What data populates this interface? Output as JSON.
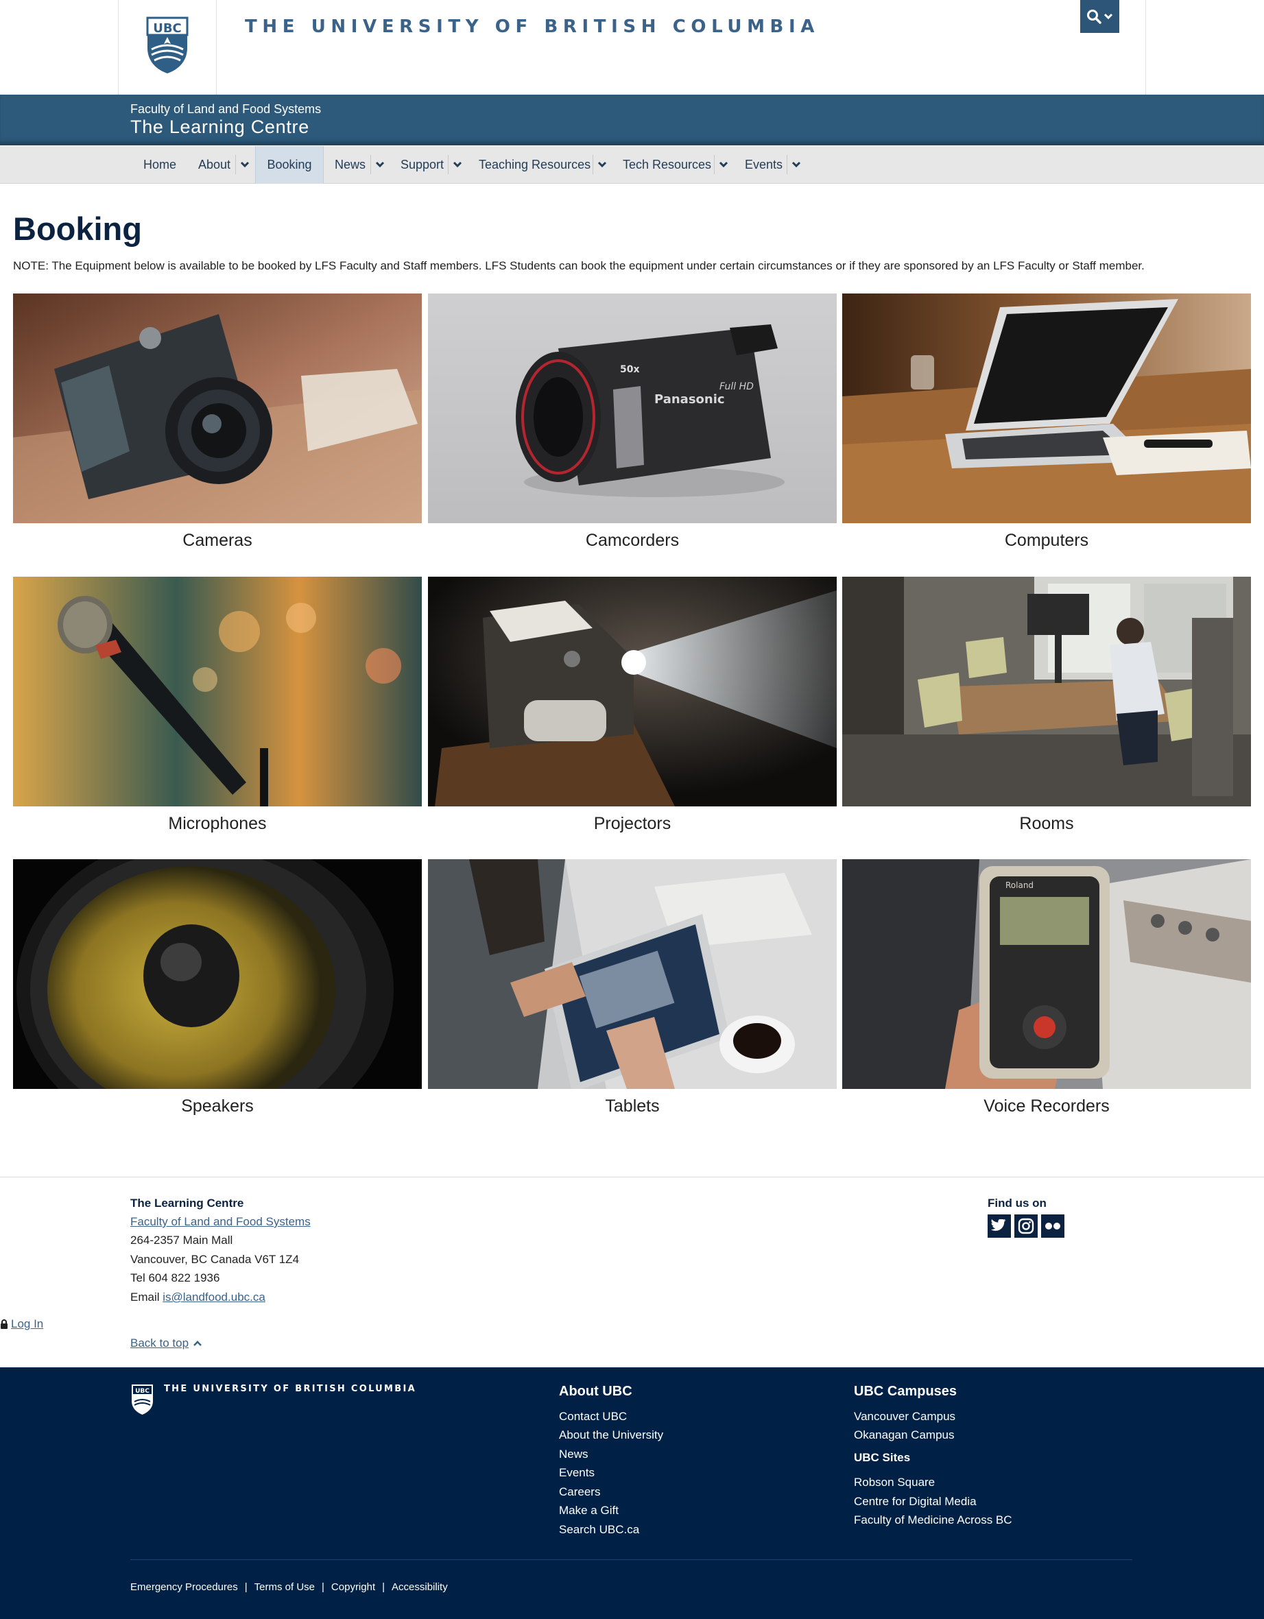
{
  "header": {
    "crest_text": "UBC",
    "wordmark": "THE UNIVERSITY OF BRITISH COLUMBIA",
    "search_icon": "search-icon"
  },
  "unit": {
    "faculty": "Faculty of Land and Food Systems",
    "name": "The Learning Centre"
  },
  "nav": {
    "items": [
      {
        "label": "Home"
      },
      {
        "label": "About"
      },
      {
        "label": "Booking"
      },
      {
        "label": "News"
      },
      {
        "label": "Support"
      },
      {
        "label": "Teaching Resources"
      },
      {
        "label": "Tech Resources"
      },
      {
        "label": "Events"
      }
    ],
    "active": "Booking"
  },
  "page": {
    "title": "Booking",
    "note": "NOTE: The Equipment below is available to be booked by LFS Faculty and Staff members. LFS Students can book the equipment under certain circumstances or if they are sponsored by an LFS Faculty or Staff member."
  },
  "tiles": [
    {
      "label": "Cameras",
      "icon": "camera-photo"
    },
    {
      "label": "Camcorders",
      "icon": "camcorder-photo"
    },
    {
      "label": "Computers",
      "icon": "laptop-photo"
    },
    {
      "label": "Microphones",
      "icon": "microphone-photo"
    },
    {
      "label": "Projectors",
      "icon": "projector-photo"
    },
    {
      "label": "Rooms",
      "icon": "room-photo"
    },
    {
      "label": "Speakers",
      "icon": "speaker-photo"
    },
    {
      "label": "Tablets",
      "icon": "tablet-photo"
    },
    {
      "label": "Voice Recorders",
      "icon": "voice-recorder-photo"
    }
  ],
  "photo_text": {
    "camcorder_brand": "Panasonic",
    "camcorder_zoom": "50x",
    "camcorder_hd": "Full HD",
    "recorder_brand": "Roland"
  },
  "unit_footer": {
    "title": "The Learning Centre",
    "faculty_link": "Faculty of Land and Food Systems",
    "address1": "264-2357 Main Mall",
    "address2": "Vancouver, BC Canada V6T 1Z4",
    "tel": "Tel 604 822 1936",
    "email_label": "Email",
    "email": "is@landfood.ubc.ca",
    "find_us": "Find us on",
    "social": [
      "twitter-icon",
      "instagram-icon",
      "flickr-icon"
    ],
    "login": "Log In",
    "back_to_top": "Back to top"
  },
  "global_footer": {
    "wordmark": "THE UNIVERSITY OF BRITISH COLUMBIA",
    "about_heading": "About UBC",
    "about_links": [
      "Contact UBC",
      "About the University",
      "News",
      "Events",
      "Careers",
      "Make a Gift",
      "Search UBC.ca"
    ],
    "campuses_heading": "UBC Campuses",
    "campus_links": [
      "Vancouver Campus",
      "Okanagan Campus"
    ],
    "sites_heading": "UBC Sites",
    "site_links": [
      "Robson Square",
      "Centre for Digital Media",
      "Faculty of Medicine Across BC"
    ],
    "bottom_links": [
      "Emergency Procedures",
      "Terms of Use",
      "Copyright",
      "Accessibility"
    ]
  },
  "colors": {
    "ubc_blue": "#002145",
    "unit_bar": "#2d5a7b",
    "nav_bg": "#e7e7e7",
    "link": "#3b6289"
  }
}
